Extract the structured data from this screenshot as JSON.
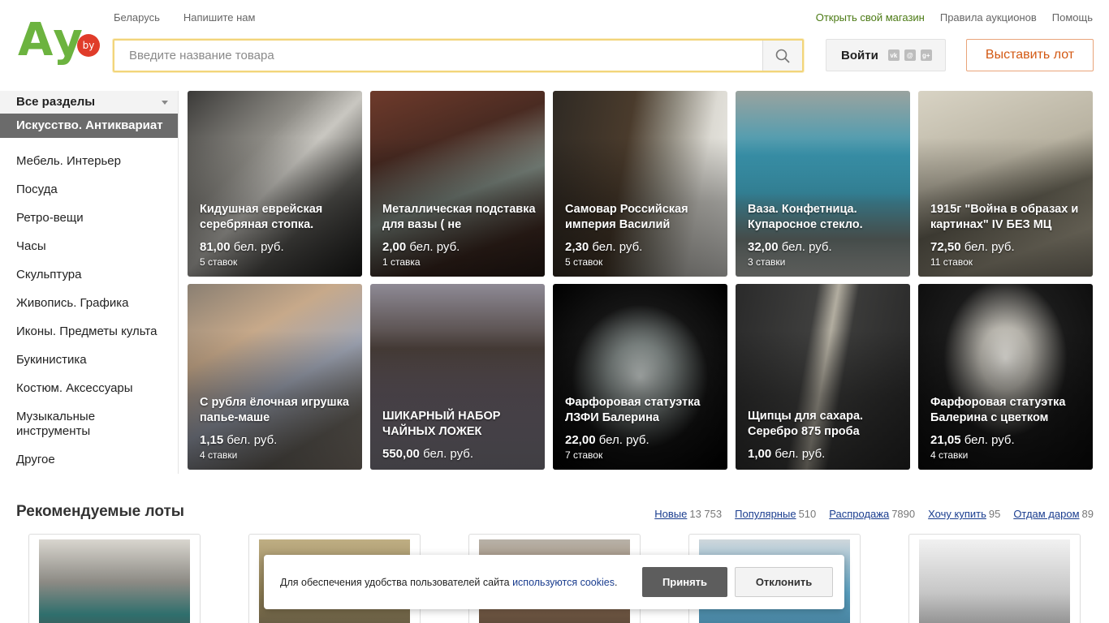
{
  "header": {
    "logo_text": "Ау",
    "logo_badge": "by",
    "top_left": [
      "Беларусь",
      "Напишите нам"
    ],
    "top_right": [
      "Открыть свой магазин",
      "Правила аукционов",
      "Помощь"
    ],
    "search_placeholder": "Введите название товара",
    "login_label": "Войти",
    "social_icons": [
      "vk-icon",
      "mail-ru-icon",
      "google-plus-icon"
    ],
    "sell_button": "Выставить лот"
  },
  "sidebar": {
    "all_label": "Все разделы",
    "active": "Искусство. Антиквариат",
    "items": [
      {
        "label": "Мебель. Интерьер"
      },
      {
        "label": "Посуда"
      },
      {
        "label": "Ретро-вещи"
      },
      {
        "label": "Часы"
      },
      {
        "label": "Скульптура"
      },
      {
        "label": "Живопись. Графика"
      },
      {
        "label": "Иконы. Предметы культа"
      },
      {
        "label": "Букинистика"
      },
      {
        "label": "Костюм. Аксессуары"
      },
      {
        "label": "Музыкальные инструменты"
      },
      {
        "label": "Другое"
      }
    ]
  },
  "lots": [
    {
      "title": "Кидушная еврейская серебряная стопка.",
      "price": "81,00",
      "currency": "бел. руб.",
      "bids": "5 ставок",
      "bg": "linear-gradient(135deg,#3b3a38 0%,#8e8c86 35%,#c9c7c1 50%,#5a5955 70%,#1c1c1b 100%)"
    },
    {
      "title": "Металлическая подставка для вазы ( не",
      "price": "2,00",
      "currency": "бел. руб.",
      "bids": "1 ставка",
      "bg": "linear-gradient(160deg,#6e3a2b 0%,#4a2b22 30%,#7f8a82 55%,#3f2a22 80%,#2a1d18 100%)"
    },
    {
      "title": "Самовар Российская империя Василий",
      "price": "2,30",
      "currency": "бел. руб.",
      "bids": "5 ставок",
      "bg": "linear-gradient(100deg,#2f2a24 0%,#4a3b2c 40%,#8f8a7e 60%,#dcdad3 80%,#eeede8 100%)"
    },
    {
      "title": "Ваза. Конфетница. Купаросное стекло.",
      "price": "32,00",
      "currency": "бел. руб.",
      "bids": "3 ставки",
      "bg": "linear-gradient(180deg,#9aa39f 0%,#3c9bb5 35%,#47b3cf 55%,#7d8a86 80%,#c9ccc7 100%)"
    },
    {
      "title": "1915г \"Война в образах и картинах\" IV БЕЗ МЦ",
      "price": "72,50",
      "currency": "бел. руб.",
      "bids": "11 ставок",
      "bg": "linear-gradient(160deg,#d8d3c4 0%,#b9b3a2 40%,#6a6658 60%,#a7a08c 80%,#8b8575 100%)"
    },
    {
      "title": "С рубля ёлочная игрушка папье-маше",
      "price": "1,15",
      "currency": "бел. руб.",
      "bids": "4 ставки",
      "bg": "linear-gradient(150deg,#8a7f72 0%,#c7a98a 30%,#a1a7b6 55%,#6f6a63 80%,#8f857a 100%)"
    },
    {
      "title": "ШИКАРНЫЙ НАБОР ЧАЙНЫХ ЛОЖЕК",
      "price": "550,00",
      "currency": "бел. руб.",
      "bids": "",
      "bg": "linear-gradient(180deg,#8e8a95 0%,#4a3f3a 35%,#6a6069 60%,#8d8994 100%)"
    },
    {
      "title": "Фарфоровая статуэтка ЛЗФИ Балерина",
      "price": "22,00",
      "currency": "бел. руб.",
      "bids": "7 ставок",
      "bg": "radial-gradient(ellipse at 50% 50%,#c9cfcd 0%,#7f8785 25%,#141414 55%,#000 100%)"
    },
    {
      "title": "Щипцы для сахара. Серебро 875 проба",
      "price": "1,00",
      "currency": "бел. руб.",
      "bids": "",
      "bg": "linear-gradient(100deg,#2a2a2a 0%,#3e3e3d 40%,#b2ada0 50%,#3a3a39 60%,#262626 100%)"
    },
    {
      "title": "Фарфоровая статуэтка Балерина с цветком",
      "price": "21,05",
      "currency": "бел. руб.",
      "bids": "4 ставки",
      "bg": "radial-gradient(ellipse at 50% 40%,#e7e5df 0%,#b6b3ab 20%,#1a1a1a 50%,#0a0a0a 100%)"
    }
  ],
  "recommended": {
    "title": "Рекомендуемые лоты",
    "tabs": [
      {
        "label": "Новые",
        "count": "13 753"
      },
      {
        "label": "Популярные",
        "count": "510"
      },
      {
        "label": "Распродажа",
        "count": "7890"
      },
      {
        "label": "Хочу купить",
        "count": "95"
      },
      {
        "label": "Отдам даром",
        "count": "89"
      }
    ],
    "items": [
      {
        "bg": "linear-gradient(180deg,#d9d6cf 0%,#8c8a84 40%,#2f6f6d 70%,#4b4a46 100%)"
      },
      {
        "bg": "linear-gradient(180deg,#bfae83 0%,#8a7a52 50%,#50493a 100%)"
      },
      {
        "bg": "linear-gradient(180deg,#b8b2a8 0%,#8c6d52 50%,#3d3128 100%)"
      },
      {
        "bg": "linear-gradient(180deg,#cfd7dc 0%,#5aa1c2 50%,#3a6c85 100%)"
      },
      {
        "bg": "linear-gradient(180deg,#f1f1f1 0%,#c6c6c6 50%,#6e6e6e 100%)"
      }
    ]
  },
  "cookie": {
    "text": "Для обеспечения удобства пользователей сайта",
    "link": "используются cookies",
    "tail": ".",
    "accept": "Принять",
    "decline": "Отклонить"
  },
  "colors": {
    "brand_green": "#6cb33f",
    "badge_red": "#e03c2a",
    "sell_orange": "#d35913",
    "link_blue": "#1a3d8f"
  }
}
